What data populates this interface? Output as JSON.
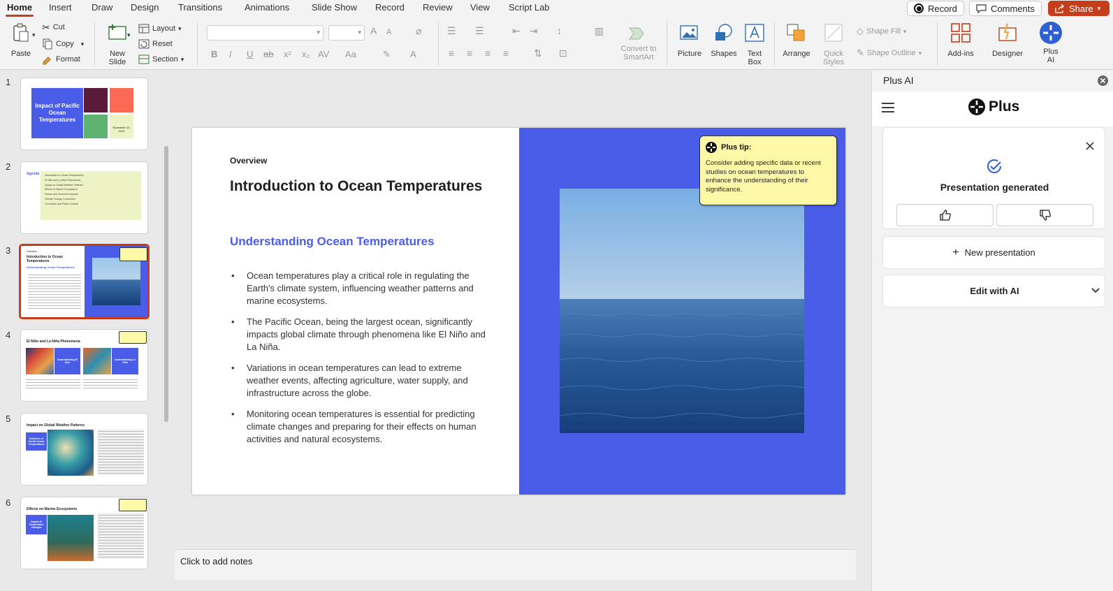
{
  "tabs": [
    "Home",
    "Insert",
    "Draw",
    "Design",
    "Transitions",
    "Animations",
    "Slide Show",
    "Record",
    "Review",
    "View",
    "Script Lab"
  ],
  "top_buttons": {
    "record": "Record",
    "comments": "Comments",
    "share": "Share"
  },
  "ribbon": {
    "paste": "Paste",
    "cut": "Cut",
    "copy": "Copy",
    "format": "Format",
    "new_slide_1": "New",
    "new_slide_2": "Slide",
    "layout": "Layout",
    "reset": "Reset",
    "section": "Section",
    "convert_1": "Convert to",
    "convert_2": "SmartArt",
    "picture": "Picture",
    "shapes": "Shapes",
    "textbox_1": "Text",
    "textbox_2": "Box",
    "arrange": "Arrange",
    "quick_1": "Quick",
    "quick_2": "Styles",
    "shape_fill": "Shape Fill",
    "shape_outline": "Shape Outline",
    "addins": "Add-ins",
    "designer": "Designer",
    "plusai_1": "Plus",
    "plusai_2": "AI",
    "font_size_a": "A",
    "bold": "B",
    "italic": "I",
    "underline": "U",
    "strike": "ab",
    "sup": "x²",
    "sub": "x₂",
    "spacing": "AV",
    "case": "Aa"
  },
  "thumbnails": {
    "numbers": [
      "1",
      "2",
      "3",
      "4",
      "5",
      "6"
    ],
    "s1_title": "Impact of Pacific Ocean Temperatures",
    "s1_date": "November 15, 2024",
    "s2_label": "Agenda",
    "s2_items": [
      "Introduction to Ocean Temperatures",
      "El Niño and La Niña Phenomena",
      "Impact on Global Weather Patterns",
      "Effects on Marine Ecosystems",
      "Human and Economic Impacts",
      "Climate Change Connection",
      "Conclusion and Future Outlook"
    ],
    "s4_title": "El Niño and La Niña Phenomena",
    "s4_box1": "Understanding El Niño",
    "s4_box2": "Understanding La Niña",
    "s5_title": "Impact on Global Weather Patterns",
    "s5_box": "Influence of Pacific Ocean Temperatures",
    "s6_title": "Effects on Marine Ecosystems",
    "s6_box": "Impact of Temperature Changes"
  },
  "slide": {
    "eyebrow": "Overview",
    "title": "Introduction to Ocean Temperatures",
    "subtitle": "Understanding Ocean Temperatures",
    "bullets": [
      "Ocean temperatures play a critical role in regulating the Earth's climate system, influencing weather patterns and marine ecosystems.",
      "The Pacific Ocean, being the largest ocean, significantly impacts global climate through phenomena like El Niño and La Niña.",
      "Variations in ocean temperatures can lead to extreme weather events, affecting agriculture, water supply, and infrastructure across the globe.",
      "Monitoring ocean temperatures is essential for predicting climate changes and preparing for their effects on human activities and natural ecosystems."
    ],
    "tip_title": "Plus tip:",
    "tip_body": "Consider adding specific data or recent studies on ocean temperatures to enhance the understanding of their significance."
  },
  "notes_placeholder": "Click to add notes",
  "pane": {
    "title": "Plus AI",
    "brand": "Plus",
    "status": "Presentation generated",
    "new_presentation": "New presentation",
    "edit_with_ai": "Edit with AI"
  },
  "colors": {
    "accent": "#c43e1c",
    "slide_blue": "#4a5de8",
    "tip_yellow": "#fdf8a8"
  }
}
